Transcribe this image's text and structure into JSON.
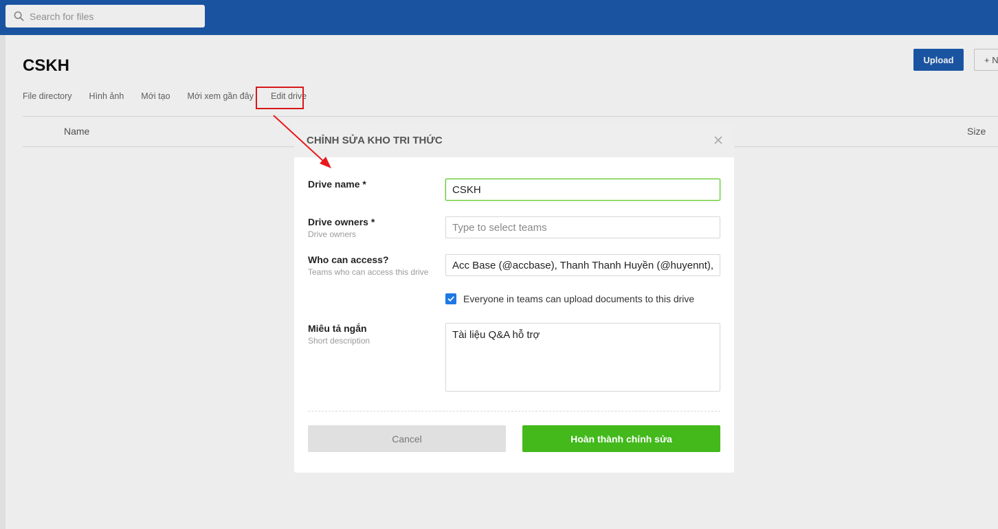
{
  "search": {
    "placeholder": "Search for files"
  },
  "page": {
    "title": "CSKH",
    "upload_label": "Upload",
    "new_label": "+ N",
    "tabs": [
      {
        "label": "File directory"
      },
      {
        "label": "Hình ảnh"
      },
      {
        "label": "Mới tạo"
      },
      {
        "label": "Mới xem gần đây"
      },
      {
        "label": "Edit drive"
      }
    ],
    "columns": {
      "name": "Name",
      "size": "Size"
    }
  },
  "modal": {
    "title": "CHỈNH SỬA KHO TRI THỨC",
    "drive_name": {
      "label": "Drive name *",
      "value": "CSKH"
    },
    "drive_owners": {
      "label": "Drive owners *",
      "sub": "Drive owners",
      "placeholder": "Type to select teams"
    },
    "access": {
      "label": "Who can access?",
      "sub": "Teams who can access this drive",
      "value": "Acc Base (@accbase), Thanh Thanh Huyền (@huyennt),"
    },
    "upload_permission": {
      "label": "Everyone in teams can upload documents to this drive",
      "checked": true
    },
    "description": {
      "label": "Miêu tả ngắn",
      "sub": "Short description",
      "value": "Tài liệu Q&A hỗ trợ"
    },
    "cancel_label": "Cancel",
    "submit_label": "Hoàn thành chỉnh sửa"
  },
  "colors": {
    "topbar": "#1c5bae",
    "primary_button": "#1c5bae",
    "submit_button": "#43b91c",
    "checkbox": "#1e78e4",
    "annotation": "#e8191c"
  }
}
